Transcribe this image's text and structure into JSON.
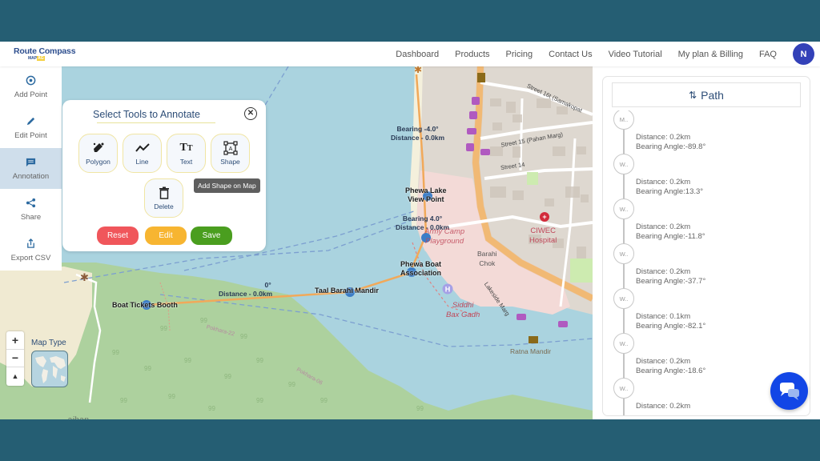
{
  "header": {
    "logo_main": "Route Compass",
    "logo_sub_a": "MAP",
    "logo_sub_b": "AG",
    "nav": [
      "Dashboard",
      "Products",
      "Pricing",
      "Contact Us",
      "Video Tutorial",
      "My plan & Billing",
      "FAQ"
    ],
    "avatar_initial": "N"
  },
  "sidebar": {
    "items": [
      {
        "label": "Add Point",
        "icon": "add-point-icon"
      },
      {
        "label": "Edit Point",
        "icon": "pencil-icon"
      },
      {
        "label": "Annotation",
        "icon": "comment-icon",
        "active": true
      },
      {
        "label": "Share",
        "icon": "share-icon"
      },
      {
        "label": "Export CSV",
        "icon": "export-icon"
      }
    ]
  },
  "annotate": {
    "title": "Select Tools to Annotate",
    "close_icon": "close-circle-icon",
    "tools": [
      {
        "label": "Polygon",
        "icon": "polygon-draw-icon"
      },
      {
        "label": "Line",
        "icon": "polyline-icon"
      },
      {
        "label": "Text",
        "icon": "text-icon"
      },
      {
        "label": "Shape",
        "icon": "shape-icon"
      },
      {
        "label": "Delete",
        "icon": "trash-icon"
      }
    ],
    "tooltip": "Add Shape on Map",
    "buttons": {
      "reset": "Reset",
      "edit": "Edit",
      "save": "Save"
    },
    "colors": {
      "reset": "#f0565b",
      "edit": "#f7b531",
      "save": "#4a9e1f"
    }
  },
  "map": {
    "labels": {
      "boat_tickets_booth": "Boat Tickets Booth",
      "taal_barahi_mandir": "Taal Barahi Mandir",
      "phewa_lake_view_point_1": "Phewa Lake",
      "phewa_lake_view_point_2": "View Point",
      "phewa_boat_assoc_1": "Phewa Boat",
      "phewa_boat_assoc_2": "Association",
      "bearing_1": "Bearing  -4.0°",
      "distance_1": "Distance - 0.0km",
      "bearing_2": "Bearing  4.0°",
      "distance_2": "Distance - 0.0km",
      "bearing_3": "0°",
      "distance_3": "Distance - 0.0km"
    },
    "pois": {
      "army_camp_1": "Army Camp",
      "army_camp_2": "Playground",
      "ciwec_1": "CIWEC",
      "ciwec_2": "Hospital",
      "siddhi_1": "Siddhi",
      "siddhi_2": "Bax Gadh",
      "ratna_mandir": "Ratna Mandir",
      "barahi_chok_1": "Barahi",
      "barahi_chok_2": "Chok",
      "baiban": "aiban",
      "pokhara22": "Pokhara-22",
      "pokhara06": "Pokhara-06"
    },
    "streets": {
      "s16": "Street 16t (Samakopat",
      "s15": "Street 15 (Pahan Marg)",
      "s14": "Street 14",
      "lakeside": "Lakeside Marg"
    },
    "controls": {
      "zoom_in": "+",
      "zoom_out": "−",
      "compass": "▲",
      "map_type_label": "Map Type"
    }
  },
  "path_panel": {
    "title": "Path",
    "title_icon": "swap-vertical-icon",
    "nodes": [
      "M..",
      "W..",
      "W..",
      "W..",
      "W..",
      "W..",
      "W.."
    ],
    "segments": [
      {
        "distance": "Distance: 0.2km",
        "bearing": "Bearing Angle:-89.8°"
      },
      {
        "distance": "Distance: 0.2km",
        "bearing": "Bearing Angle:13.3°"
      },
      {
        "distance": "Distance: 0.2km",
        "bearing": "Bearing Angle:-11.8°"
      },
      {
        "distance": "Distance: 0.2km",
        "bearing": "Bearing Angle:-37.7°"
      },
      {
        "distance": "Distance: 0.1km",
        "bearing": "Bearing Angle:-82.1°"
      },
      {
        "distance": "Distance: 0.2km",
        "bearing": "Bearing Angle:-18.6°"
      },
      {
        "distance": "Distance: 0.2km",
        "bearing": ""
      }
    ]
  },
  "chat": {
    "icon": "chat-bubbles-icon"
  }
}
